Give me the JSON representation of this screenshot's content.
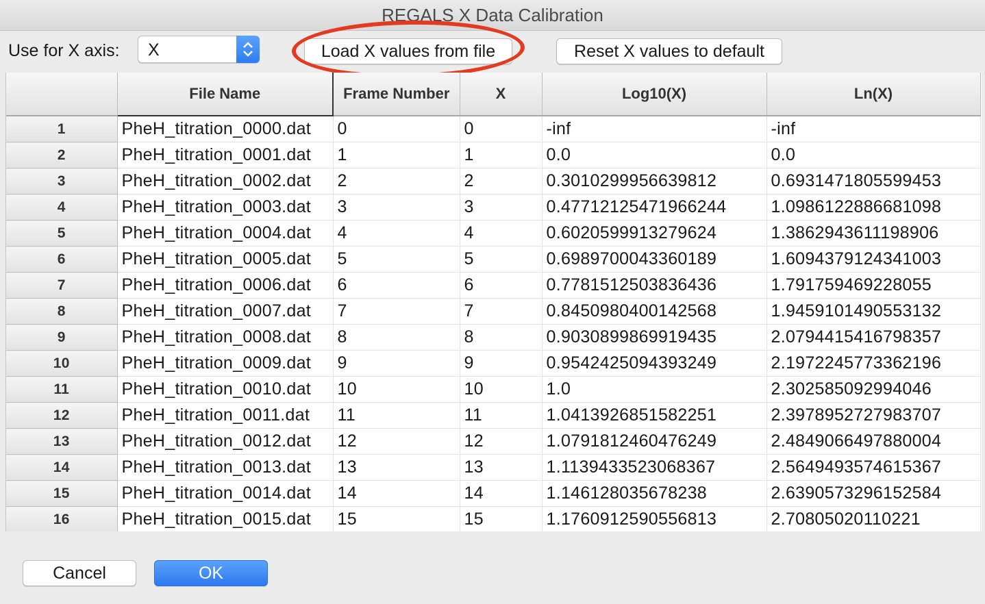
{
  "window": {
    "title": "REGALS X Data Calibration"
  },
  "toolbar": {
    "x_axis_label": "Use for X axis:",
    "x_axis_selected": "X",
    "load_button": "Load X values from file",
    "reset_button": "Reset X values to default"
  },
  "colors": {
    "accent": "#2f7cf3",
    "highlight_ring": "#e33b22"
  },
  "table": {
    "columns": [
      "",
      "File Name",
      "Frame Number",
      "X",
      "Log10(X)",
      "Ln(X)"
    ],
    "rows": [
      [
        "1",
        "PheH_titration_0000.dat",
        "0",
        "0",
        "-inf",
        "-inf"
      ],
      [
        "2",
        "PheH_titration_0001.dat",
        "1",
        "1",
        "0.0",
        "0.0"
      ],
      [
        "3",
        "PheH_titration_0002.dat",
        "2",
        "2",
        "0.3010299956639812",
        "0.6931471805599453"
      ],
      [
        "4",
        "PheH_titration_0003.dat",
        "3",
        "3",
        "0.47712125471966244",
        "1.0986122886681098"
      ],
      [
        "5",
        "PheH_titration_0004.dat",
        "4",
        "4",
        "0.6020599913279624",
        "1.3862943611198906"
      ],
      [
        "6",
        "PheH_titration_0005.dat",
        "5",
        "5",
        "0.6989700043360189",
        "1.6094379124341003"
      ],
      [
        "7",
        "PheH_titration_0006.dat",
        "6",
        "6",
        "0.7781512503836436",
        "1.791759469228055"
      ],
      [
        "8",
        "PheH_titration_0007.dat",
        "7",
        "7",
        "0.8450980400142568",
        "1.9459101490553132"
      ],
      [
        "9",
        "PheH_titration_0008.dat",
        "8",
        "8",
        "0.9030899869919435",
        "2.0794415416798357"
      ],
      [
        "10",
        "PheH_titration_0009.dat",
        "9",
        "9",
        "0.9542425094393249",
        "2.1972245773362196"
      ],
      [
        "11",
        "PheH_titration_0010.dat",
        "10",
        "10",
        "1.0",
        "2.302585092994046"
      ],
      [
        "12",
        "PheH_titration_0011.dat",
        "11",
        "11",
        "1.0413926851582251",
        "2.3978952727983707"
      ],
      [
        "13",
        "PheH_titration_0012.dat",
        "12",
        "12",
        "1.0791812460476249",
        "2.4849066497880004"
      ],
      [
        "14",
        "PheH_titration_0013.dat",
        "13",
        "13",
        "1.1139433523068367",
        "2.5649493574615367"
      ],
      [
        "15",
        "PheH_titration_0014.dat",
        "14",
        "14",
        "1.146128035678238",
        "2.6390573296152584"
      ],
      [
        "16",
        "PheH_titration_0015.dat",
        "15",
        "15",
        "1.1760912590556813",
        "2.70805020110221"
      ]
    ]
  },
  "footer": {
    "cancel_button": "Cancel",
    "ok_button": "OK"
  }
}
